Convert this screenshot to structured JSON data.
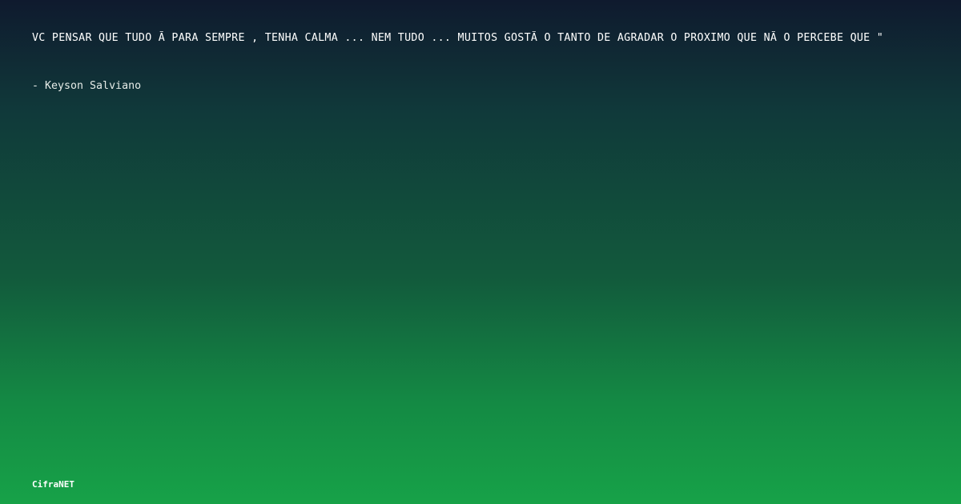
{
  "quote": {
    "text": "VC PENSAR QUE TUDO Ã  PARA SEMPRE , TENHA CALMA ... NEM TUDO ... MUITOS GOSTÃ O TANTO DE AGRADAR O PROXIMO QUE NÃ O PERCEBE QUE \"",
    "author": "- Keyson Salviano"
  },
  "footer": {
    "brand": "CifraNET"
  }
}
